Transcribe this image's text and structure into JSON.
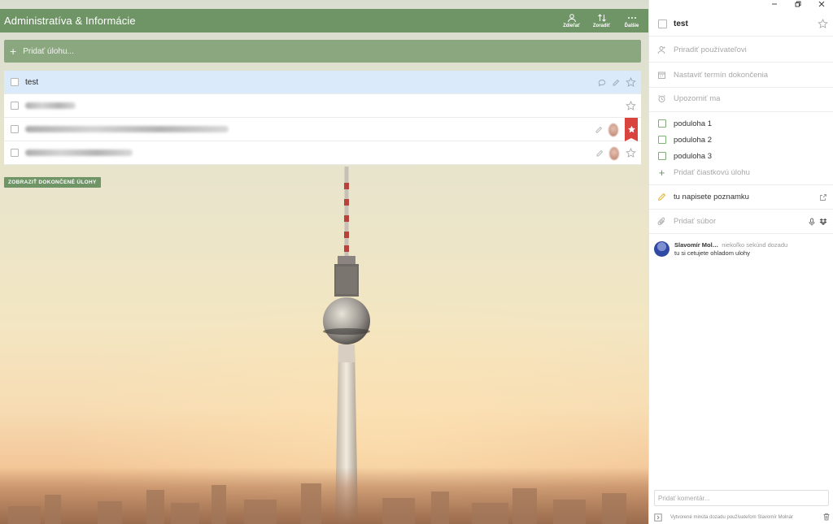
{
  "list": {
    "title": "Administratíva & Informácie",
    "actions": [
      {
        "label": "Zdieľať",
        "icon": "share-user-icon"
      },
      {
        "label": "Zoradiť",
        "icon": "sort-icon"
      },
      {
        "label": "Ďalšie",
        "icon": "more-icon"
      }
    ],
    "add_task_placeholder": "Pridať úlohu...",
    "show_completed_label": "ZOBRAZIŤ DOKONČENÉ ÚLOHY",
    "tasks": [
      {
        "title": "test",
        "selected": true,
        "starred": false
      },
      {
        "title": "",
        "selected": false,
        "starred": false
      },
      {
        "title": "",
        "selected": false,
        "starred": true
      },
      {
        "title": "",
        "selected": false,
        "starred": false
      }
    ]
  },
  "detail": {
    "title": "test",
    "assign_label": "Priradiť používateľovi",
    "due_label": "Nastaviť termín dokončenia",
    "remind_label": "Upozorniť ma",
    "subtasks": [
      "poduloha 1",
      "poduloha 2",
      "poduloha 3"
    ],
    "add_subtask_label": "Pridať čiastkovú úlohu",
    "note": "tu napisete poznamku",
    "add_file_label": "Pridať súbor",
    "comment": {
      "author": "Slavomír Mol…",
      "time": "niekoľko sekúnd dozadu",
      "text": "tu si cetujete ohladom ulohy"
    },
    "comment_placeholder": "Pridať komentár...",
    "footer_text": "Vytvorené minúta dozadu používateľom Slavomír Molnár"
  },
  "colors": {
    "header_green": "#6f9466",
    "selected_row": "#dbeafb",
    "star_flag_red": "#d9443f"
  }
}
